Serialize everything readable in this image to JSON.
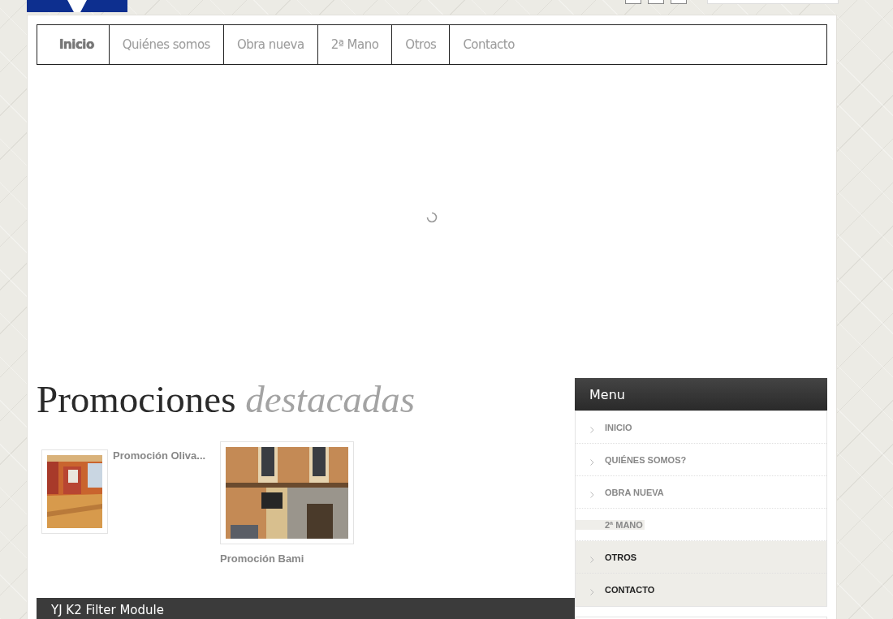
{
  "nav": [
    {
      "label": "Inicio",
      "selected": true
    },
    {
      "label": "Quiénes somos",
      "selected": false
    },
    {
      "label": "Obra nueva",
      "selected": false
    },
    {
      "label": "2ª Mano",
      "selected": false
    },
    {
      "label": "Otros",
      "selected": false
    },
    {
      "label": "Contacto",
      "selected": false
    }
  ],
  "promotions": {
    "title": "Promociones",
    "title_accent": "destacadas",
    "items": [
      {
        "title": "Promoción Oliva...",
        "kind": "side"
      },
      {
        "title": "Promoción Bami",
        "kind": "below"
      }
    ]
  },
  "filter_module": {
    "title": "YJ K2 Filter Module"
  },
  "menu": {
    "title": "Menu",
    "items": [
      {
        "label": "INICIO",
        "highlighted": false,
        "arrow": true
      },
      {
        "label": "QUIÉNES SOMOS?",
        "highlighted": false,
        "arrow": true
      },
      {
        "label": "OBRA NUEVA",
        "highlighted": false,
        "arrow": true
      },
      {
        "label": "2ª MANO",
        "highlighted": false,
        "arrow": false
      },
      {
        "label": "OTROS",
        "highlighted": true,
        "arrow": true
      },
      {
        "label": "CONTACTO",
        "highlighted": true,
        "arrow": true
      }
    ]
  }
}
